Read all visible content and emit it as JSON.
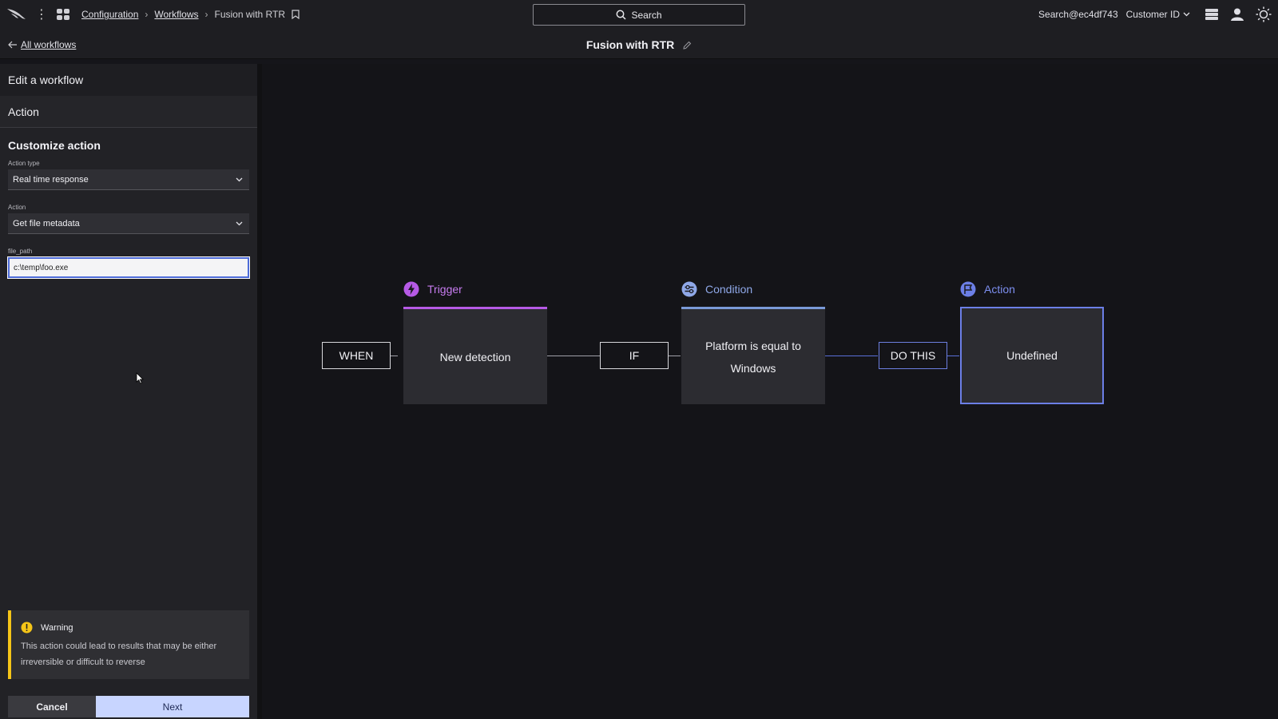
{
  "topbar": {
    "breadcrumbs": [
      "Configuration",
      "Workflows",
      "Fusion with RTR"
    ],
    "search_label": "Search",
    "user": "Search@ec4df743",
    "customer": "Customer ID"
  },
  "subbar": {
    "back_label": "All workflows",
    "title": "Fusion with RTR"
  },
  "panel": {
    "heading": "Edit a workflow",
    "step": "Action",
    "section_title": "Customize action",
    "action_type": {
      "label": "Action type",
      "value": "Real time response"
    },
    "action": {
      "label": "Action",
      "value": "Get file metadata"
    },
    "file_path": {
      "label": "file_path",
      "value": "c:\\temp\\foo.exe"
    },
    "warning": {
      "title": "Warning",
      "text": "This action could lead to results that may be either irreversible or difficult to reverse"
    },
    "cancel_label": "Cancel",
    "next_label": "Next"
  },
  "canvas": {
    "connectors": {
      "when": "WHEN",
      "if": "IF",
      "do_this": "DO THIS"
    },
    "trigger": {
      "label": "Trigger",
      "text": "New detection",
      "color": "#b65ae6"
    },
    "condition": {
      "label": "Condition",
      "text": "Platform is equal to Windows",
      "color": "#8fa8e8"
    },
    "action": {
      "label": "Action",
      "text": "Undefined",
      "color": "#7d8ff0"
    }
  }
}
